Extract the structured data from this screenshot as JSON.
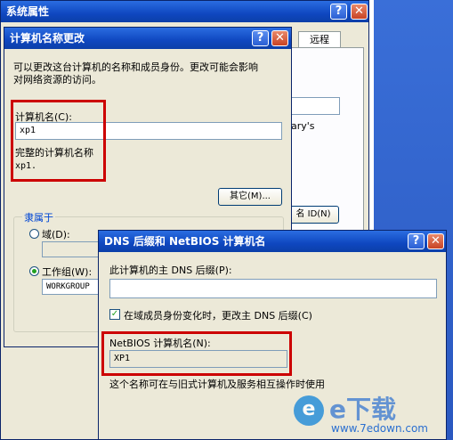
{
  "system_props": {
    "title": "系统属性",
    "tab_remote": "远程",
    "bg_text": "ary's",
    "bg_button": "名 ID(N)"
  },
  "computer_name_dialog": {
    "title": "计算机名称更改",
    "description_1": "可以更改这台计算机的名称和成员身份。更改可能会影响",
    "description_2": "对网络资源的访问。",
    "computer_name_label": "计算机名(C):",
    "computer_name_value": "xp1",
    "full_name_label": "完整的计算机名称",
    "full_name_value": "xp1.",
    "more_button": "其它(M)...",
    "member_of_label": "隶属于",
    "domain_label": "域(D):",
    "workgroup_label": "工作组(W):",
    "workgroup_value": "WORKGROUP"
  },
  "dns_dialog": {
    "title": "DNS 后缀和 NetBIOS 计算机名",
    "primary_dns_label": "此计算机的主 DNS 后缀(P):",
    "primary_dns_value": "",
    "change_checkbox_label": "在域成员身份变化时，更改主 DNS 后缀(C)",
    "netbios_label": "NetBIOS 计算机名(N):",
    "netbios_value": "XP1",
    "footer_text": "这个名称可在与旧式计算机及服务相互操作时使用"
  },
  "watermark": {
    "brand": "e下载",
    "url": "www.7edown.com"
  },
  "colors": {
    "title_bar": "#0f47c0",
    "highlight_box": "#cc0000",
    "dialog_bg": "#ece9d8"
  }
}
